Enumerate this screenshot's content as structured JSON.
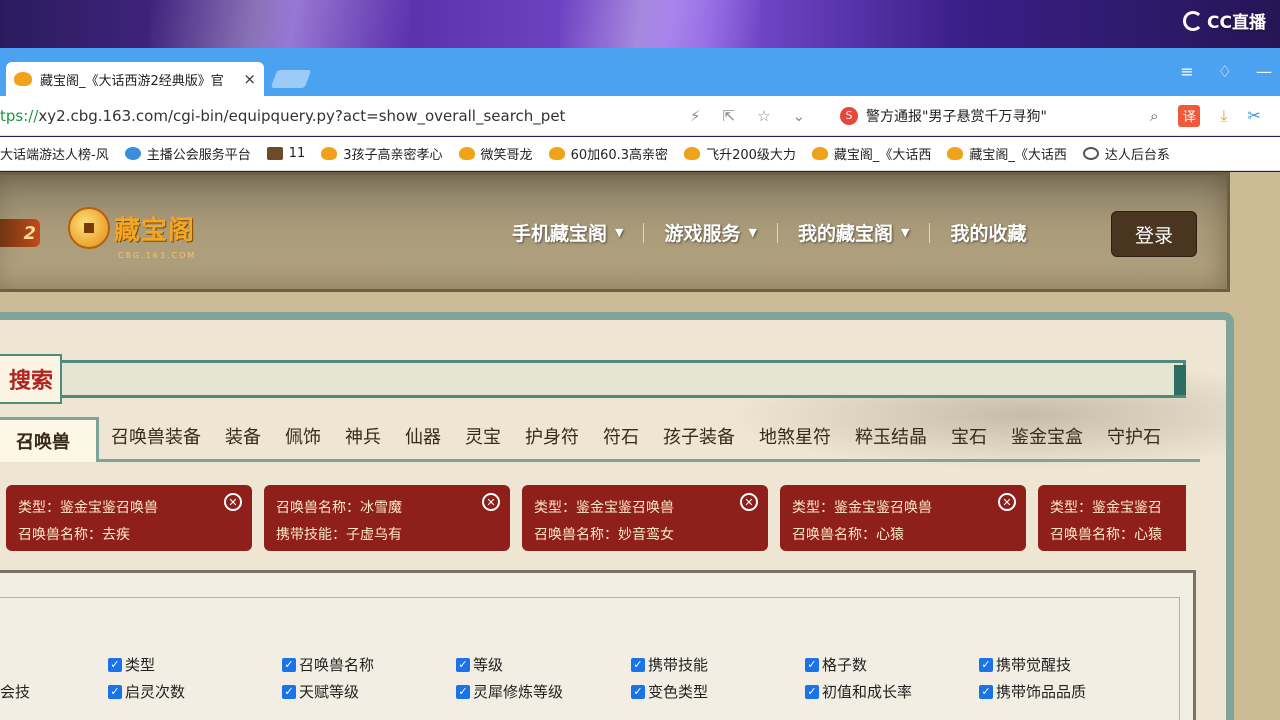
{
  "stream": {
    "logo": "CC直播"
  },
  "browser": {
    "tab_title": "藏宝阁_《大话西游2经典版》官",
    "tab_close": "×",
    "url_proto": "tps://",
    "url_rest": "xy2.cbg.163.com/cgi-bin/equipquery.py?act=show_overall_search_pet",
    "news_text": "警方通报\"男子悬赏千万寻狗\"",
    "translate_label": "译"
  },
  "bookmarks": [
    "大话端游达人榜-风",
    "主播公会服务平台",
    "11",
    "3孩子高亲密孝心",
    "微笑哥龙",
    "60加60.3高亲密",
    "飞升200级大力",
    "藏宝阁_《大话西",
    "藏宝阁_《大话西",
    "达人后台系"
  ],
  "site": {
    "game_logo": "2",
    "cbg_name": "藏宝阁",
    "cbg_sub": "CBG.163.COM",
    "nav": [
      "手机藏宝阁",
      "游戏服务",
      "我的藏宝阁",
      "我的收藏"
    ],
    "login": "登录",
    "search_label": "搜索",
    "tabs": [
      "召唤兽",
      "召唤兽装备",
      "装备",
      "佩饰",
      "神兵",
      "仙器",
      "灵宝",
      "护身符",
      "符石",
      "孩子装备",
      "地煞星符",
      "粹玉结晶",
      "宝石",
      "鉴金宝盒",
      "守护石"
    ]
  },
  "chips": [
    {
      "line1": "类型：鉴金宝鉴召唤兽",
      "line2": "召唤兽名称：去疾"
    },
    {
      "line1": "召唤兽名称：冰雪魔",
      "line2": "携带技能：子虚乌有"
    },
    {
      "line1": "类型：鉴金宝鉴召唤兽",
      "line2": "召唤兽名称：妙音鸾女"
    },
    {
      "line1": "类型：鉴金宝鉴召唤兽",
      "line2": "召唤兽名称：心猿"
    },
    {
      "line1": "类型：鉴金宝鉴召",
      "line2": "召唤兽名称：心猿"
    }
  ],
  "filters": {
    "row1": [
      "类型",
      "召唤兽名称",
      "等级",
      "携带技能",
      "格子数",
      "携带觉醒技"
    ],
    "row2_lead": "会技",
    "row2": [
      "启灵次数",
      "天赋等级",
      "灵犀修炼等级",
      "变色类型",
      "初值和成长率",
      "携带饰品品质"
    ]
  }
}
